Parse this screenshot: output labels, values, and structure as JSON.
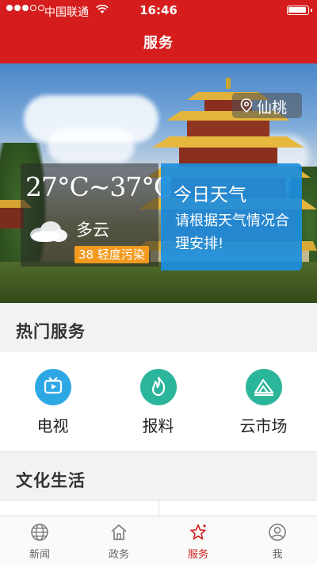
{
  "status_bar": {
    "carrier": "中国联通",
    "time": "16:46"
  },
  "header": {
    "title": "服务"
  },
  "hero": {
    "location": "仙桃",
    "weather": {
      "temperature": "27°C~37°C",
      "condition": "多云",
      "air_quality": "38 轻度污染"
    },
    "tip": {
      "title": "今日天气",
      "text": "请根据天气情况合理安排!"
    }
  },
  "sections": {
    "hot_services": {
      "title": "热门服务",
      "items": [
        {
          "label": "电视",
          "icon": "tv-icon",
          "color": "#2ea8e5"
        },
        {
          "label": "报料",
          "icon": "flame-icon",
          "color": "#2bb59a"
        },
        {
          "label": "云市场",
          "icon": "market-icon",
          "color": "#2bb59a"
        }
      ]
    },
    "culture": {
      "title": "文化生活"
    }
  },
  "tabbar": {
    "items": [
      {
        "label": "新闻",
        "icon": "globe-icon"
      },
      {
        "label": "政务",
        "icon": "home-icon"
      },
      {
        "label": "服务",
        "icon": "star-icon",
        "active": true
      },
      {
        "label": "我",
        "icon": "user-icon"
      }
    ],
    "active_color": "#d51d1d"
  },
  "colors": {
    "brand_red": "#d51d1d",
    "weather_blue": "#1c8ede",
    "aqi_orange": "#f39a1e"
  }
}
